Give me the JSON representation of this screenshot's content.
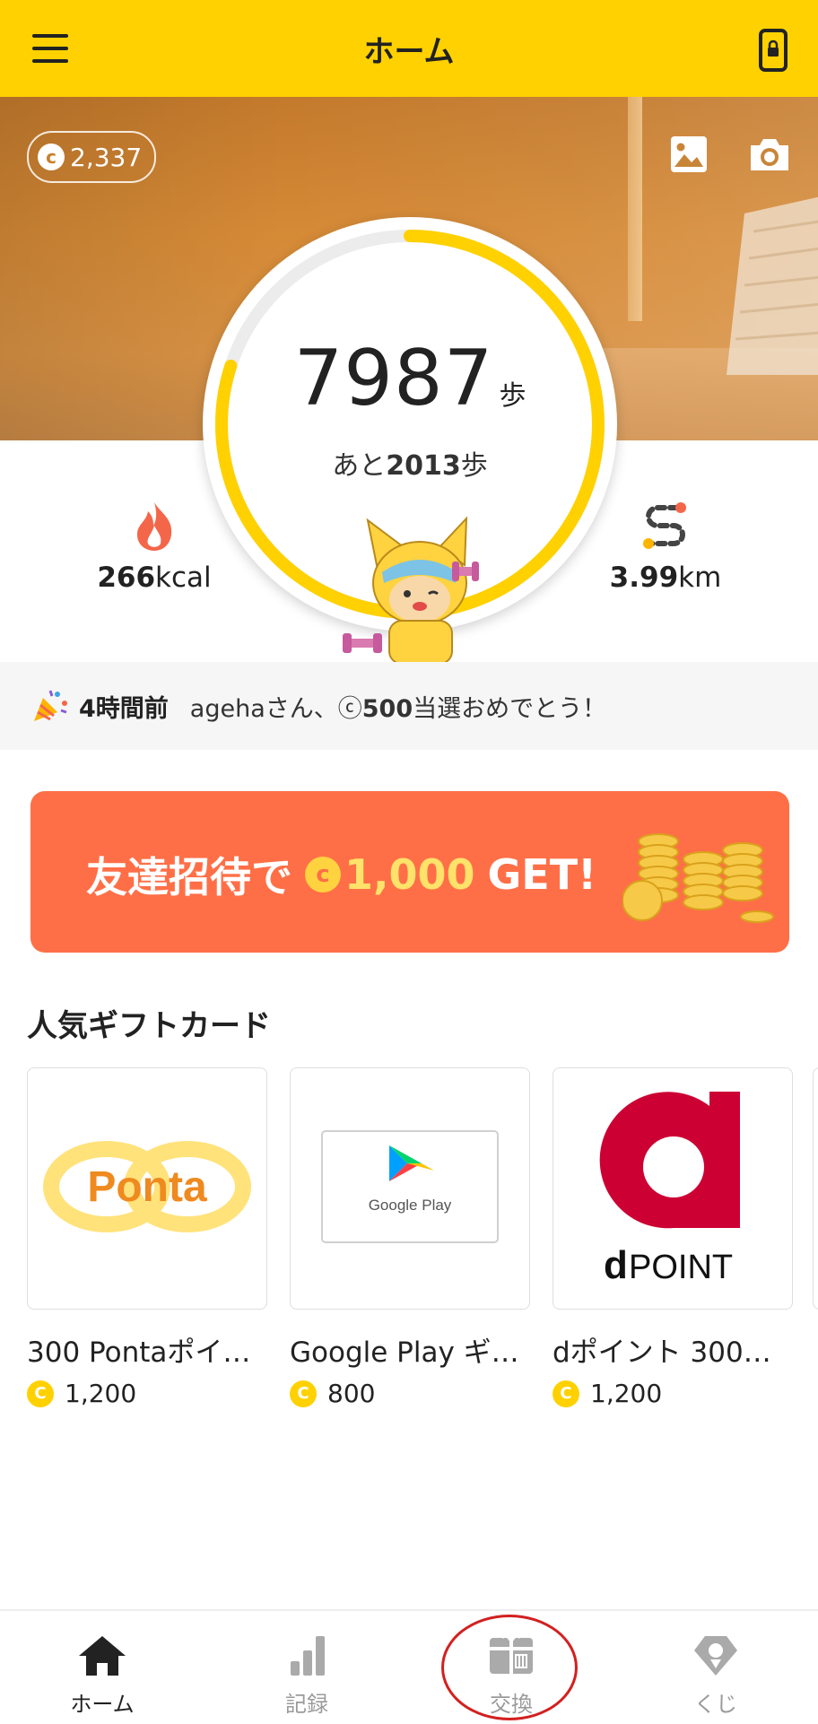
{
  "header": {
    "title": "ホーム",
    "menu_icon": "hamburger-menu-icon",
    "right_icon": "phone-lock-icon"
  },
  "hero": {
    "coin_balance": "2,337",
    "coin_symbol": "c",
    "steps": "7987",
    "steps_unit": "歩",
    "remaining_prefix": "あと",
    "remaining_steps": "2013",
    "remaining_unit": "歩",
    "step_goal_progress": 0.8,
    "calories_value": "266",
    "calories_unit": "kcal",
    "distance_value": "3.99",
    "distance_unit": "km"
  },
  "news": {
    "time": "4時間前",
    "message_prefix": "agehaさん、",
    "coin_symbol": "ⓒ",
    "amount": "500",
    "message_suffix": "当選おめでとう！"
  },
  "banner": {
    "prefix": "友達招待で",
    "coin_symbol": "c",
    "amount": "1,000",
    "suffix": "GET!"
  },
  "gift_section": {
    "title": "人気ギフトカード",
    "cards": [
      {
        "name": "300 Pontaポイ…",
        "price": "1,200",
        "brand": "Ponta"
      },
      {
        "name": "Google Play ギ…",
        "price": "800",
        "brand": "Google Play"
      },
      {
        "name": "dポイント 300…",
        "price": "1,200",
        "brand": "POINT"
      }
    ]
  },
  "nav": {
    "tabs": [
      {
        "label": "ホーム",
        "icon": "home-icon",
        "active": true
      },
      {
        "label": "記録",
        "icon": "bar-chart-icon",
        "active": false
      },
      {
        "label": "交換",
        "icon": "gift-exchange-icon",
        "active": false
      },
      {
        "label": "くじ",
        "icon": "lottery-icon",
        "active": false
      }
    ]
  },
  "colors": {
    "brand_yellow": "#FFD100",
    "banner_orange": "#FF6F47",
    "annotation_red": "#D32020"
  }
}
